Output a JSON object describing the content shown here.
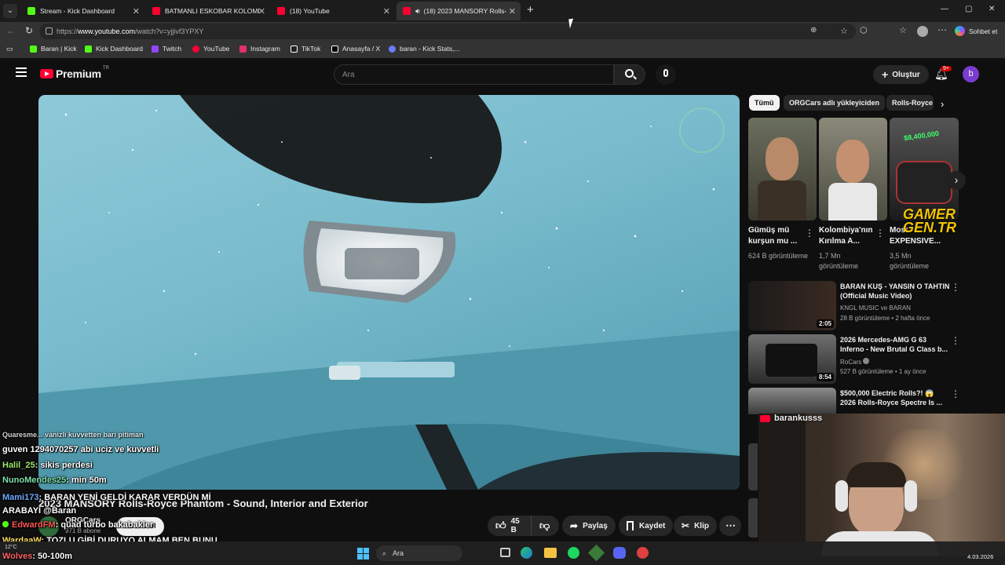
{
  "browser": {
    "tabs": [
      {
        "label": "Stream - Kick Dashboard",
        "color": "#53fc18"
      },
      {
        "label": "BATMANLI ESKOBAR KOLOMBİYA'",
        "color": "#ff0033"
      },
      {
        "label": "(18) YouTube",
        "color": "#ff0033"
      },
      {
        "label": "(18) 2023 MANSORY Rolls-Ro",
        "color": "#ff0033"
      }
    ],
    "new_tab": "+",
    "url_prefix": "https://",
    "url_host": "www.youtube.com",
    "url_path": "/watch?v=yjjivf3YPXY",
    "copilot": "Sohbet et",
    "bookmarks": [
      {
        "label": "Baran | Kick",
        "color": "#53fc18"
      },
      {
        "label": "Kick Dashboard",
        "color": "#53fc18"
      },
      {
        "label": "Twitch",
        "color": "#9146ff"
      },
      {
        "label": "YouTube",
        "color": "#ff0033"
      },
      {
        "label": "Instagram",
        "color": "#e1306c"
      },
      {
        "label": "TikTok",
        "color": "#ffffff"
      },
      {
        "label": "Anasayfa / X",
        "color": "#ffffff"
      },
      {
        "label": "baran - Kick Stats,...",
        "color": "#6b7cff"
      }
    ]
  },
  "youtube": {
    "logo": "Premium",
    "logo_region": "TR",
    "search_placeholder": "Ara",
    "create_label": "Oluştur",
    "notifications": "9+",
    "avatar_letter": "b",
    "chips": [
      "Tümü",
      "ORGCars adlı yükleyiciden",
      "Rolls-Royce"
    ],
    "shorts": [
      {
        "title": "Gümüş mü kurşun mu ...",
        "views": "624 B görüntüleme"
      },
      {
        "title": "Kolombiya'nın Kırılma A...",
        "views": "1,7 Mn görüntüleme"
      },
      {
        "title": "Most EXPENSIVE...",
        "views": "3,5 Mn görüntüleme",
        "badge": "$8,400,000"
      }
    ],
    "recommended": [
      {
        "title": "BARAN KUŞ - YANSIN O TAHTIN (Official Music Video)",
        "channel": "KNGL MUSIC ve BARAN",
        "meta": "28 B görüntüleme • 2 hafta önce",
        "duration": "2:05"
      },
      {
        "title": "2026 Mercedes-AMG G 63 Inferno - New Brutal G Class b...",
        "channel": "RoCars",
        "meta": "527 B görüntüleme • 1 ay önce",
        "duration": "8:54"
      },
      {
        "title": "$500,000 Electric Rolls?! 😱 2026 Rolls-Royce Spectre Is ...",
        "channel": "",
        "meta": "",
        "duration": ""
      }
    ],
    "video_title": "2023 MANSORY Rolls-Royce Phantom - Sound, Interior and Exterior",
    "channel_name": "ORGCars",
    "subscribers": "971 B abone",
    "subscribe_label": "Abone ol",
    "likes": "45 B",
    "share_label": "Paylaş",
    "save_label": "Kaydet",
    "clip_label": "Klip",
    "watermark": "GAMER GEN.TR"
  },
  "stream": {
    "streamer": "barankusss",
    "chat": [
      {
        "user": "",
        "msg": "Quaresme... vanizli kuvvetten bari pitiman"
      },
      {
        "user": "guven",
        "msg": "1294070257 abi uciz ve kuvvetli",
        "color": "#ffffff"
      },
      {
        "user": "Halil_25",
        "msg": ": sikis perdesi",
        "color": "#9be86b"
      },
      {
        "user": "NunoMendes25",
        "msg": ": min 50m",
        "color": "#7ee0a8"
      },
      {
        "user": "Mami173",
        "msg": ": BARAN YENİ GELDİ KARAR VERDÜN Mİ ARABAYI @Baran",
        "color": "#6fa8ff"
      },
      {
        "user": "EdwardFM",
        "msg": ": quad turbo bakabakler",
        "color": "#ff5555"
      },
      {
        "user": "WardaaW",
        "msg": ": TOZLU GİBİ DURUYO ALMAM BEN BUNU",
        "color": "#ffe060"
      },
      {
        "user": "Wolves",
        "msg": ": 50-100m",
        "color": "#ff6666"
      }
    ]
  },
  "taskbar": {
    "search_label": "Ara",
    "weather_temp": "12°C",
    "clock_date": "4.03.2026"
  },
  "colors": {
    "accent_red": "#ff0033",
    "kick_green": "#53fc18"
  }
}
